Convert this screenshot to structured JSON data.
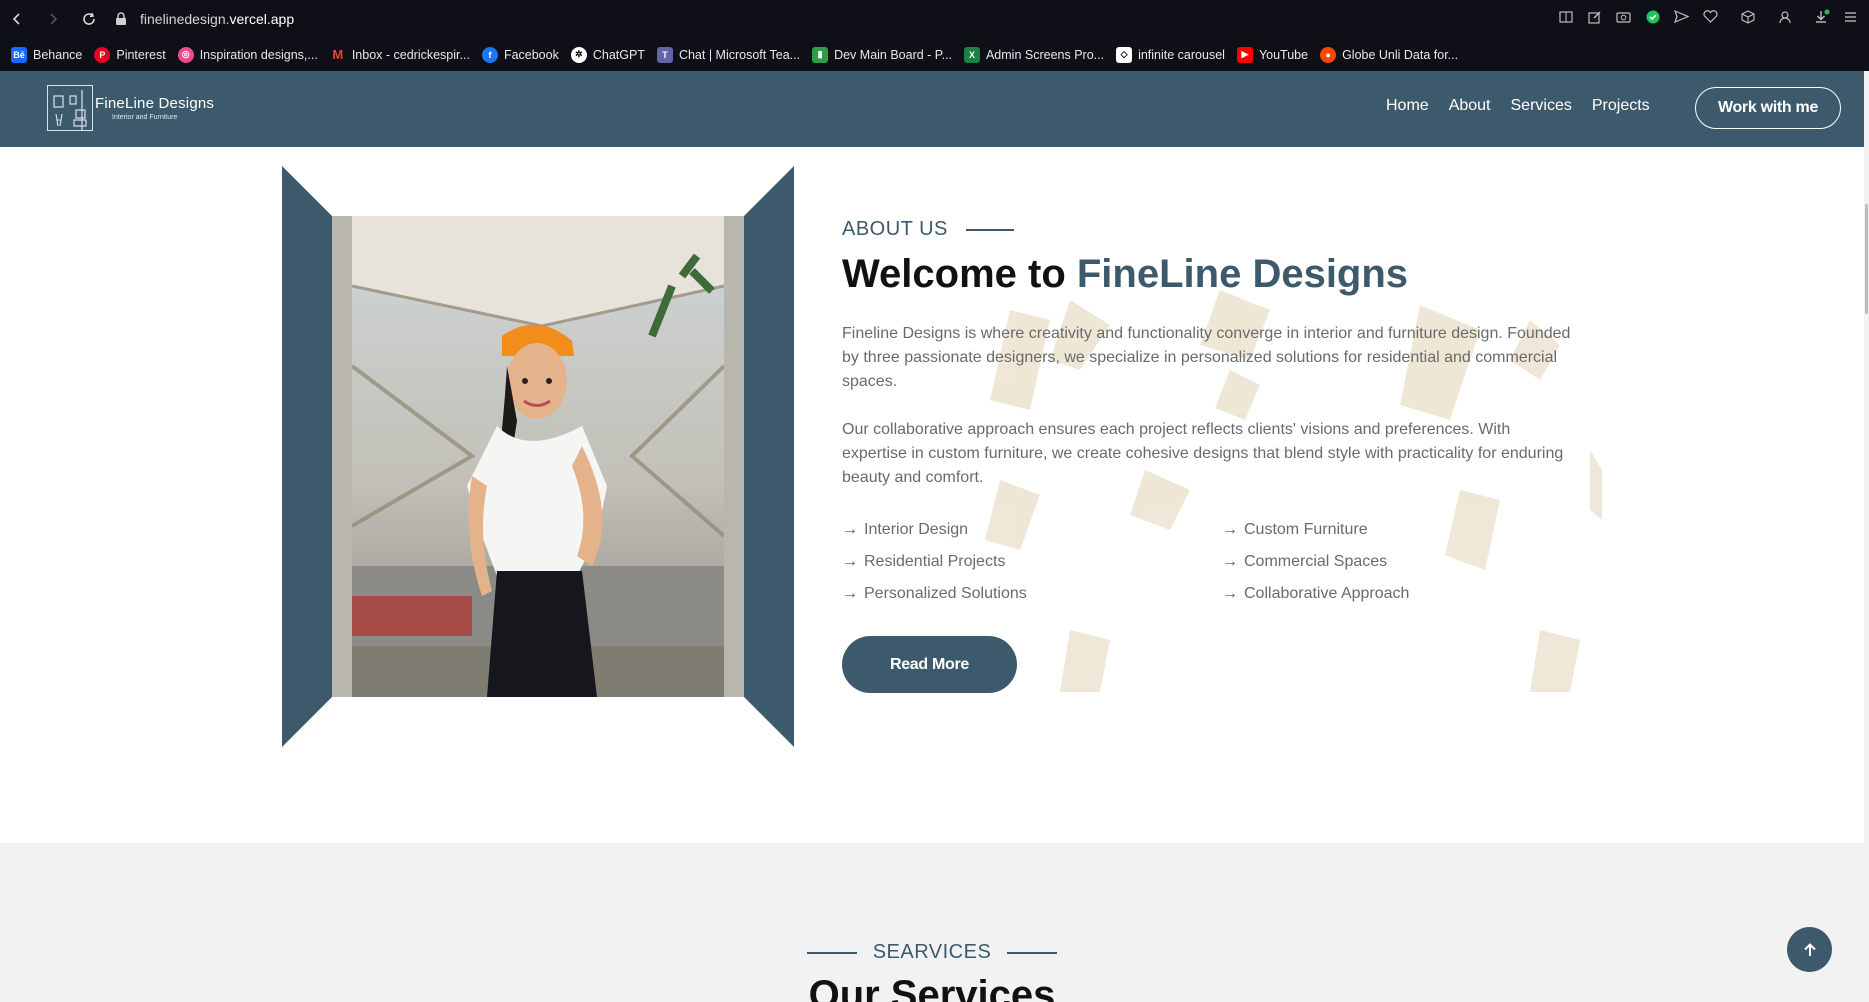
{
  "browser": {
    "url_host": "finelinedesign.",
    "url_domain": "vercel.app",
    "bookmarks": [
      {
        "label": "Behance",
        "icon": "behance-icon",
        "color": "#1769ff"
      },
      {
        "label": "Pinterest",
        "icon": "pinterest-icon",
        "color": "#e60023"
      },
      {
        "label": "Inspiration designs,...",
        "icon": "dribbble-icon",
        "color": "#ea4c89"
      },
      {
        "label": "Inbox - cedrickespir...",
        "icon": "gmail-icon",
        "color": "#ea4335"
      },
      {
        "label": "Facebook",
        "icon": "facebook-icon",
        "color": "#1877f2"
      },
      {
        "label": "ChatGPT",
        "icon": "chatgpt-icon",
        "color": "#ffffff"
      },
      {
        "label": "Chat | Microsoft Tea...",
        "icon": "teams-icon",
        "color": "#6264a7"
      },
      {
        "label": "Dev Main Board - P...",
        "icon": "board-icon",
        "color": "#2e9e48"
      },
      {
        "label": "Admin Screens Pro...",
        "icon": "excel-icon",
        "color": "#1d7f45"
      },
      {
        "label": "infinite carousel",
        "icon": "codesandbox-icon",
        "color": "#ffffff"
      },
      {
        "label": "YouTube",
        "icon": "youtube-icon",
        "color": "#ff0000"
      },
      {
        "label": "Globe Unli Data for...",
        "icon": "reddit-icon",
        "color": "#ff4500"
      }
    ]
  },
  "header": {
    "logo_name": "FineLine Designs",
    "logo_sub": "Interior and Furniture",
    "nav": [
      "Home",
      "About",
      "Services",
      "Projects"
    ],
    "cta": "Work with me"
  },
  "about": {
    "eyebrow": "ABOUT US",
    "title_prefix": "Welcome to ",
    "title_accent": "FineLine Designs",
    "p1": "Fineline Designs is where creativity and functionality converge in interior and furniture design. Founded by three passionate designers, we specialize in personalized solutions for residential and commercial spaces.",
    "p2": "Our collaborative approach ensures each project reflects clients' visions and preferences. With expertise in custom furniture, we create cohesive designs that blend style with practicality for enduring beauty and comfort.",
    "features_left": [
      "Interior Design",
      "Residential Projects",
      "Personalized Solutions"
    ],
    "features_right": [
      "Custom Furniture",
      "Commercial Spaces",
      "Collaborative Approach"
    ],
    "read_more": "Read More"
  },
  "services": {
    "eyebrow": "SEARVICES",
    "title": "Our Services"
  },
  "colors": {
    "brand": "#3d5a6c",
    "chrome": "#0f1017",
    "section_bg": "#f2f2f2"
  }
}
